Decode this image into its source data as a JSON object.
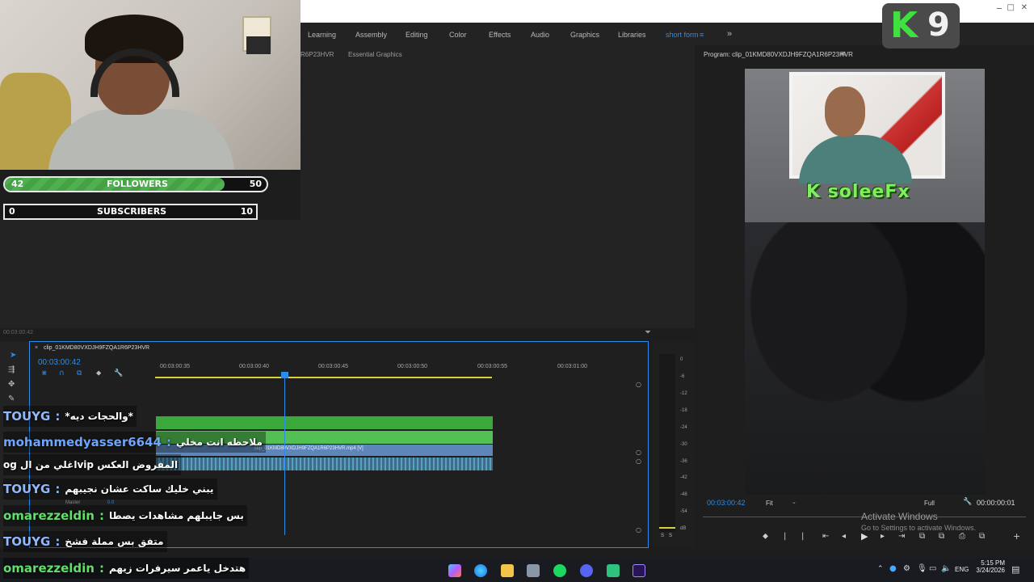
{
  "webcam": {
    "label": ""
  },
  "stats": {
    "followers": {
      "current": "42",
      "label": "FOLLOWERS",
      "goal": "50",
      "fraction": 0.84
    },
    "subscribers": {
      "current": "0",
      "label": "SUBSCRIBERS",
      "goal": "10",
      "fraction": 0.0
    }
  },
  "workspace": {
    "tabs": [
      "Learning",
      "Assembly",
      "Editing",
      "Color",
      "Effects",
      "Audio",
      "Graphics",
      "Libraries",
      "short form"
    ],
    "active": "short form",
    "overflow_icon": "double-chevron-right-icon"
  },
  "source_panel": {
    "tab_partial": "R6P23HVR",
    "tab_essential": "Essential Graphics",
    "timecode": "00:03:00:42"
  },
  "program": {
    "title": "Program: clip_01KMD80VXDJH9FZQA1R6P23HVR",
    "brand": "K soleeFx",
    "timecode_left": "00:03:00:42",
    "fit": "Fit",
    "quality": "Full",
    "timecode_right": "00:00:00:01"
  },
  "k9_logo": {
    "k": "K",
    "n": "9"
  },
  "timeline": {
    "sequence": "clip_01KMD80VXDJH9FZQA1R6P23HVR",
    "timecode": "00:03:00:42",
    "ruler": [
      "00:03:00:35",
      "00:03:00:40",
      "00:03:00:45",
      "00:03:00:50",
      "00:03:00:55",
      "00:03:01:00"
    ],
    "clip_label": "clip_01KMD80VXDJH9FZQA1R6P23HVR.mp4 [V]",
    "track_label": "Master",
    "track_value": "0.0"
  },
  "meter": {
    "db": [
      "0",
      "-6",
      "-12",
      "-18",
      "-24",
      "-30",
      "-36",
      "-42",
      "-48",
      "-54",
      "dB"
    ],
    "solo": "S"
  },
  "chat": [
    {
      "user": "TOUYG",
      "sep": ":",
      "msg": "*والحجات ديه*",
      "color": "#8fb9ff"
    },
    {
      "user": "mohammedyasser6644",
      "sep": ":",
      "msg": "ملاحظه انت مخلي",
      "color": "#6ea6ff"
    },
    {
      "user": "",
      "sep": "",
      "msg": "المفروض العكس vipاغلي من ال og",
      "color": "#ffffff"
    },
    {
      "user": "TOUYG",
      "sep": ":",
      "msg": "يبني خليك ساكت عشان نجيبهم",
      "color": "#8fb9ff"
    },
    {
      "user": "omarezzeldin",
      "sep": ":",
      "msg": "بس جايبلهم مشاهدات يصطا",
      "color": "#5fe06a"
    },
    {
      "user": "TOUYG",
      "sep": ":",
      "msg": "متفق بس مملة فشخ",
      "color": "#8fb9ff"
    },
    {
      "user": "omarezzeldin",
      "sep": ":",
      "msg": "هتدخل ياعمر سيرفرات زيهم",
      "color": "#5fe06a"
    }
  ],
  "activate_windows": {
    "title": "Activate Windows",
    "sub": "Go to Settings to activate Windows."
  },
  "taskbar": {
    "lang": "ENG",
    "time": "5:15 PM",
    "date": "3/24/2026"
  }
}
